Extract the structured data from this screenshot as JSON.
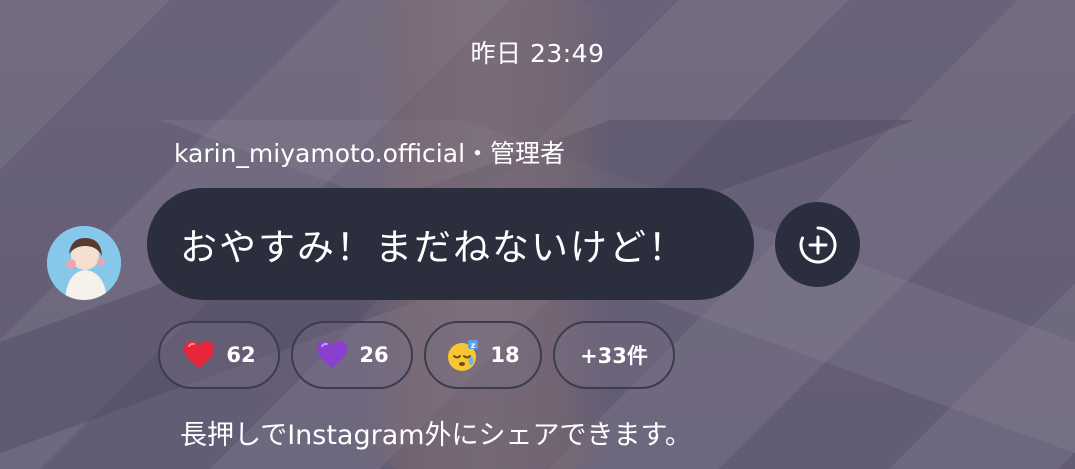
{
  "timestamp": "昨日 23:49",
  "sender": "karin_miyamoto.official・管理者",
  "message": "おやすみ！まだねないけど！",
  "add_reaction_icon": "add-reaction-icon",
  "reactions": [
    {
      "icon": "red-heart-icon",
      "count": "62"
    },
    {
      "icon": "purple-heart-icon",
      "count": "26"
    },
    {
      "icon": "sleepy-face-icon",
      "count": "18"
    },
    {
      "label": "+33件"
    }
  ],
  "footer_note": "長押しでInstagram外にシェアできます。",
  "colors": {
    "bubble": "#2b2e3d",
    "text": "#ffffff",
    "red_heart": "#e8263a",
    "purple_heart": "#8b3fd1"
  }
}
